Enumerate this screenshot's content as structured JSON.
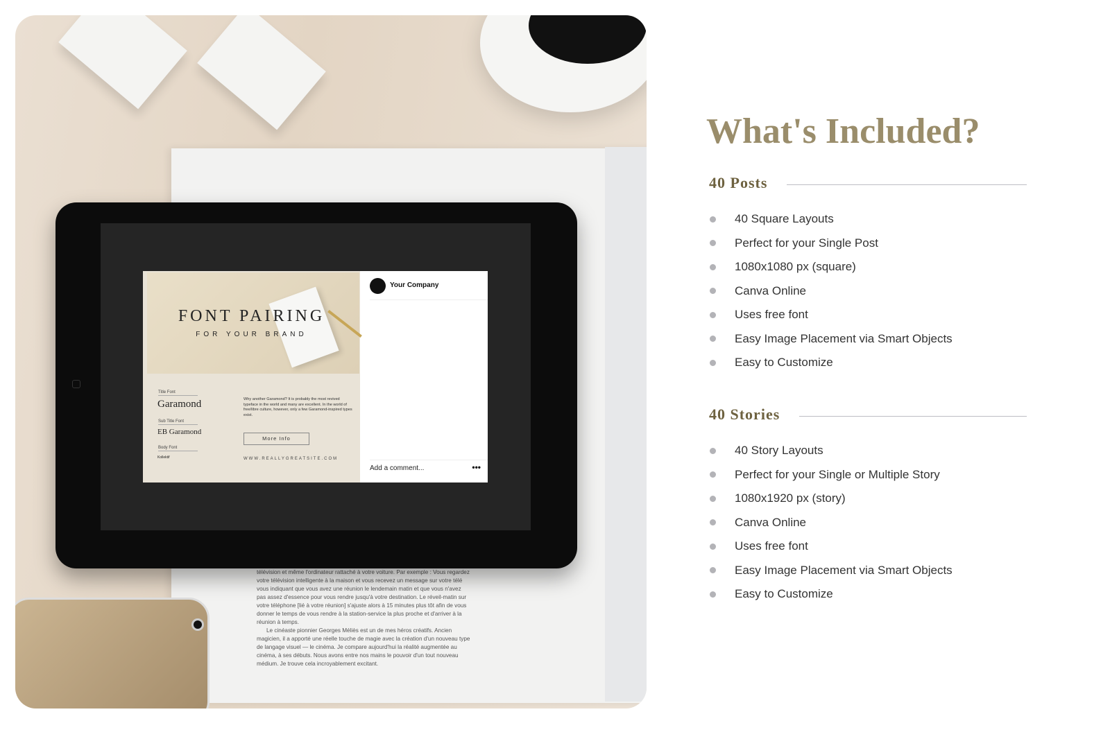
{
  "photo": {
    "post_card": {
      "title": "FONT PAIRING",
      "subtitle": "FOR YOUR BRAND",
      "title_font_label": "Title Font",
      "title_font": "Garamond",
      "subtitle_font_label": "Sub Title Font",
      "subtitle_font": "EB Garamond",
      "body_font_label": "Body Font",
      "body_font": "Kollektif",
      "description": "Why another Garamond? It is probably the most revived typeface in the world and many are excellent. In the world of free/libre culture, however, only a few Garamond-inspired types exist.",
      "button": "More Info",
      "website": "WWW.REALLYGREATSITE.COM"
    },
    "social": {
      "company": "Your Company",
      "comment_placeholder": "Add a comment...",
      "more": "•••"
    },
    "magazine_text": [
      "télévision et même l'ordinateur rattaché à votre voiture. Par exemple : Vous regardez votre télévision intelligente à la maison et vous recevez un message sur votre télé vous indiquant que vous avez une réunion le lendemain matin et que vous n'avez pas assez d'essence pour vous rendre jusqu'à votre destination. Le réveil-matin sur votre téléphone [lié à votre réunion] s'ajuste alors à 15 minutes plus tôt afin de vous donner le temps de vous rendre à la station-service la plus proche et d'arriver à la réunion à temps.",
      "Le cinéaste pionnier Georges Méliès est un de mes héros créatifs. Ancien magicien, il a apporté une réelle touche de magie avec la création d'un nouveau type de langage visuel — le cinéma. Je compare aujourd'hui la réalité augmentée au cinéma, à ses débuts. Nous avons entre nos mains le pouvoir d'un tout nouveau médium. Je trouve cela incroyablement excitant."
    ]
  },
  "title": "What's Included?",
  "sections": [
    {
      "heading": "40 Posts",
      "items": [
        "40 Square Layouts",
        "Perfect for your Single Post",
        "1080x1080 px (square)",
        "Canva Online",
        "Uses free font",
        "Easy Image Placement via Smart Objects",
        "Easy to Customize"
      ]
    },
    {
      "heading": "40 Stories",
      "items": [
        "40 Story Layouts",
        "Perfect for your Single or Multiple Story",
        "1080x1920 px (story)",
        "Canva Online",
        "Uses free font",
        "Easy Image Placement via Smart Objects",
        "Easy to Customize"
      ]
    }
  ],
  "colors": {
    "title": "#9a8d6b",
    "heading": "#6e6240",
    "bullet": "#b3b3b7"
  }
}
